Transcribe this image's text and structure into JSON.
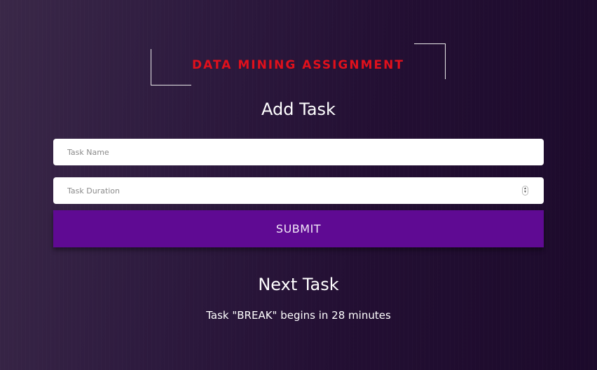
{
  "banner": {
    "title": "DATA MINING ASSIGNMENT"
  },
  "add_task": {
    "title": "Add Task",
    "name_placeholder": "Task Name",
    "duration_placeholder": "Task Duration",
    "submit_label": "SUBMIT"
  },
  "next_task": {
    "title": "Next Task",
    "message": "Task \"BREAK\" begins in 28 minutes"
  },
  "colors": {
    "banner_title": "#e0101c",
    "submit_button": "#5f0a93",
    "background": "#2a1739"
  }
}
